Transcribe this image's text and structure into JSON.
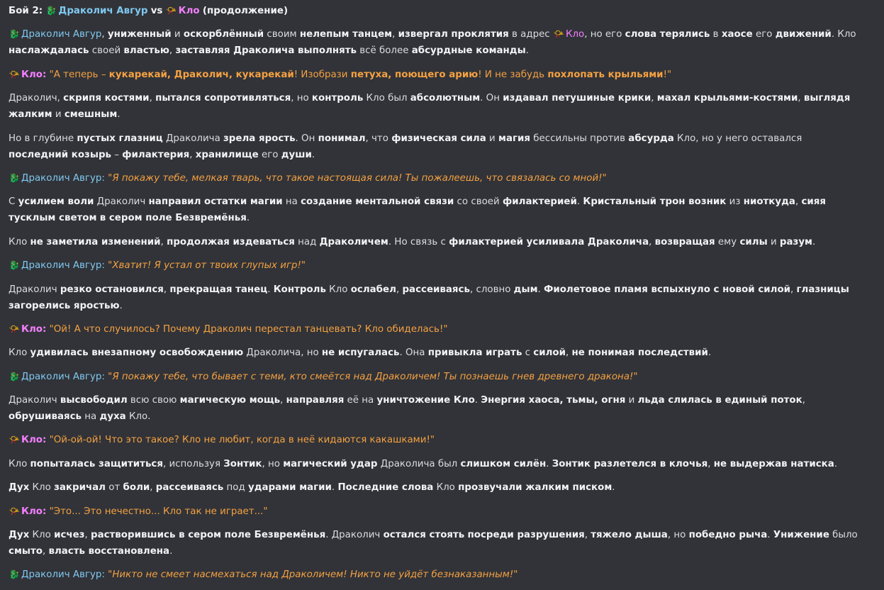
{
  "icons": {
    "dragon": "dragon-icon",
    "horn": "party-horn-icon"
  },
  "names": {
    "dragon": "Драколич Авгур",
    "klo": "Кло"
  },
  "colors": {
    "background": "#313338",
    "text": "#dbdee1",
    "bold": "#f2f3f5",
    "dragon_name": "#80c8f0",
    "klo_name": "#f47fff",
    "quote": "#f5a142"
  },
  "title": {
    "prefix": "Бой 2:",
    "vs": "vs",
    "suffix": "(продолжение)"
  },
  "p1": {
    "s1": ", ",
    "b1": "униженный",
    "s2": " и ",
    "b2": "оскорблённый",
    "s3": " своим ",
    "b3": "нелепым танцем",
    "s4": ", ",
    "b4": "извергал проклятия",
    "s5": " в адрес ",
    "s6": ", но его ",
    "b5": "слова терялись",
    "s7": " в ",
    "b6": "хаосе",
    "s8": " его ",
    "b7": "движений",
    "s9": ". Кло ",
    "b8": "наслаждалась",
    "s10": " своей ",
    "b9": "властью",
    "s11": ", ",
    "b10": "заставляя Драколича выполнять",
    "s12": " всё более ",
    "b11": "абсурдные команды",
    "s13": "."
  },
  "q1": {
    "t1": "\"А теперь – ",
    "o1": "кукарекай, Драколич, кукарекай",
    "t2": "! Изобрази ",
    "o2": "петуха, поющего арию",
    "t3": "! И не забудь ",
    "o3": "похлопать крыльями",
    "t4": "!\""
  },
  "p2": {
    "s1": "Драколич, ",
    "b1": "скрипя костями",
    "s2": ", ",
    "b2": "пытался сопротивляться",
    "s3": ", но ",
    "b3": "контроль",
    "s4": " Кло был ",
    "b4": "абсолютным",
    "s5": ". Он ",
    "b5": "издавал петушиные крики",
    "s6": ", ",
    "b6": "махал крыльями-костями",
    "s7": ", ",
    "b7": "выглядя жалким",
    "s8": " и ",
    "b8": "смешным",
    "s9": "."
  },
  "p3": {
    "s1": "Но в глубине ",
    "b1": "пустых глазниц",
    "s2": " Драколича ",
    "b2": "зрела ярость",
    "s3": ". Он ",
    "b3": "понимал",
    "s4": ", что ",
    "b4": "физическая сила",
    "s5": " и ",
    "b5": "магия",
    "s6": " бессильны против ",
    "b6": "абсурда",
    "s7": " Кло, но у него оставался ",
    "b7": "последний козырь",
    "s8": " – ",
    "b8": "филактерия",
    "s9": ", ",
    "b9": "хранилище",
    "s10": " его ",
    "b10": "души",
    "s11": "."
  },
  "d1": "\"Я покажу тебе, мелкая тварь, что такое настоящая сила! Ты пожалеешь, что связалась со мной!\"",
  "p4": {
    "s1": "С ",
    "b1": "усилием воли",
    "s2": " Драколич ",
    "b2": "направил остатки магии",
    "s3": " на ",
    "b3": "создание ментальной связи",
    "s4": " со своей ",
    "b4": "филактерией",
    "s5": ". ",
    "b5": "Кристальный трон возник",
    "s6": " из ",
    "b6": "ниоткуда",
    "s7": ", ",
    "b7": "сияя тусклым светом",
    "s8": " ",
    "b8": "в сером поле Безвремёнья",
    "s9": "."
  },
  "p5": {
    "s1": "Кло ",
    "b1": "не заметила изменений",
    "s2": ", ",
    "b2": "продолжая издеваться",
    "s3": " над ",
    "b3": "Драколичем",
    "s4": ". Но связь с ",
    "b4": "филактерией усиливала Драколича",
    "s5": ", ",
    "b5": "возвращая",
    "s6": " ему ",
    "b6": "силы",
    "s7": " и ",
    "b7": "разум",
    "s8": "."
  },
  "d2": "\"Хватит! Я устал от твоих глупых игр!\"",
  "p6": {
    "s1": "Драколич ",
    "b1": "резко остановился",
    "s2": ", ",
    "b2": "прекращая танец",
    "s3": ". ",
    "b3": "Контроль",
    "s4": " Кло ",
    "b4": "ослабел",
    "s5": ", ",
    "b5": "рассеиваясь",
    "s6": ", словно ",
    "b6": "дым",
    "s7": ". ",
    "b7": "Фиолетовое пламя вспыхнуло с новой силой",
    "s8": ", ",
    "b8": "глазницы загорелись яростью",
    "s9": "."
  },
  "q2": "\"Ой! А что случилось? Почему Драколич перестал танцевать? Кло обиделась!\"",
  "p7": {
    "s1": "Кло ",
    "b1": "удивилась внезапному освобождению",
    "s2": " Драколича, но ",
    "b2": "не испугалась",
    "s3": ". Она ",
    "b3": "привыкла играть",
    "s4": " с ",
    "b4": "силой",
    "s5": ", ",
    "b5": "не понимая последствий",
    "s6": "."
  },
  "d3": "\"Я покажу тебе, что бывает с теми, кто смеётся над Драколичем! Ты познаешь гнев древнего дракона!\"",
  "p8": {
    "s1": "Драколич ",
    "b1": "высвободил",
    "s2": " всю свою ",
    "b2": "магическую мощь",
    "s3": ", ",
    "b3": "направляя",
    "s4": " её на ",
    "b4": "уничтожение Кло",
    "s5": ". ",
    "b5": "Энергия хаоса, тьмы, огня",
    "s6": " и ",
    "b6": "льда слилась в единый поток",
    "s7": ", ",
    "b7": "обрушиваясь",
    "s8": " на ",
    "b8": "духа",
    "s9": " Кло."
  },
  "q3": "\"Ой-ой-ой! Что это такое? Кло не любит, когда в неё кидаются какашками!\"",
  "p9": {
    "s1": "Кло ",
    "b1": "попыталась защититься",
    "s2": ", используя ",
    "b2": "Зонтик",
    "s3": ", но ",
    "b3": "магический удар",
    "s4": " Драколича был ",
    "b4": "слишком силён",
    "s5": ". ",
    "b5": "Зонтик разлетелся в клочья",
    "s6": ", ",
    "b6": "не выдержав натиска",
    "s7": "."
  },
  "p10": {
    "b1": "Дух",
    "s1": " Кло ",
    "b2": "закричал",
    "s2": " от ",
    "b3": "боли",
    "s3": ", ",
    "b4": "рассеиваясь",
    "s4": " под ",
    "b5": "ударами магии",
    "s5": ". ",
    "b6": "Последние слова",
    "s6": " Кло ",
    "b7": "прозвучали жалким писком",
    "s7": "."
  },
  "q4": "\"Это... Это нечестно... Кло так не играет...\"",
  "p11": {
    "b1": "Дух",
    "s1": " Кло ",
    "b2": "исчез",
    "s2": ", ",
    "b3": "растворившись в сером поле Безвремёнья",
    "s3": ". Драколич ",
    "b4": "остался стоять",
    "s4": " ",
    "b5": "посреди разрушения",
    "s5": ", ",
    "b6": "тяжело дыша",
    "s6": ", но ",
    "b7": "победно рыча",
    "s7": ". ",
    "b8": "Унижение",
    "s8": " было ",
    "b9": "смыто",
    "s9": ", ",
    "b10": "власть восстановлена",
    "s10": "."
  },
  "d4": "\"Никто не смеет насмехаться над Драколичем! Никто не уйдёт безнаказанным!\""
}
